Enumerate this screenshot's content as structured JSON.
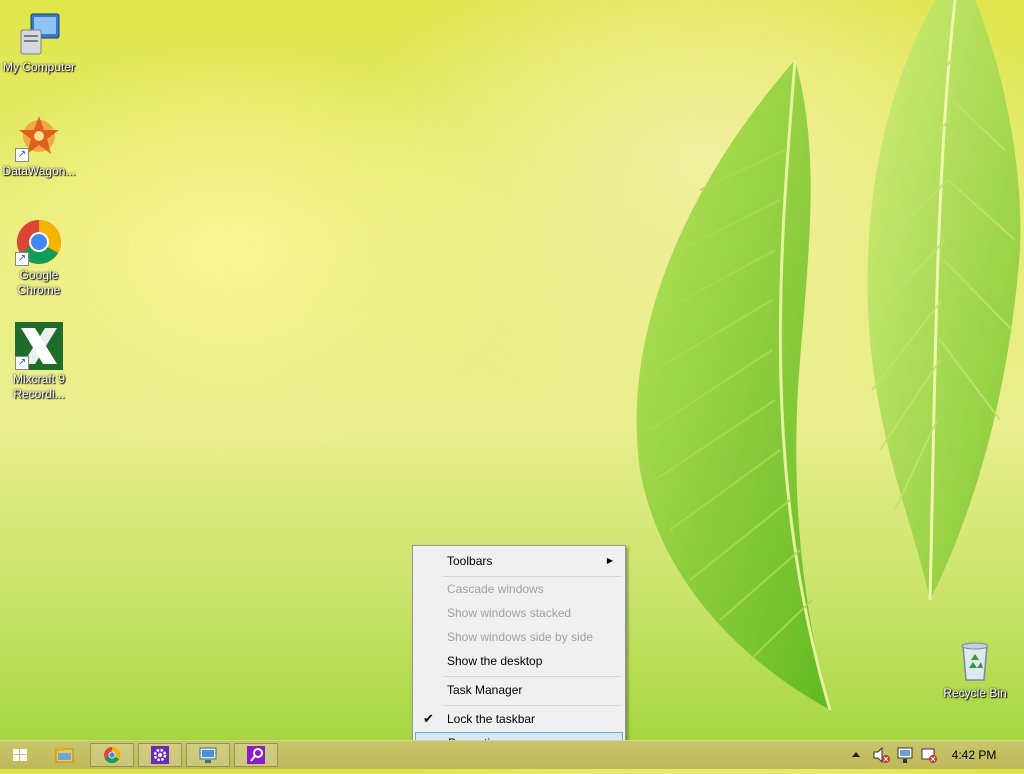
{
  "desktop": {
    "icons": [
      {
        "label": "My Computer",
        "icon": "computer-icon"
      },
      {
        "label": "DataWagon...",
        "icon": "datawagon-icon"
      },
      {
        "label": "Google Chrome",
        "icon": "chrome-icon"
      },
      {
        "label": "Mixcraft 9 Recordi...",
        "icon": "mixcraft-icon"
      },
      {
        "label": "Recycle Bin",
        "icon": "recycle-bin-icon"
      }
    ]
  },
  "context_menu": {
    "items": [
      {
        "label": "Toolbars",
        "enabled": true,
        "submenu": true
      },
      {
        "label": "Cascade windows",
        "enabled": false
      },
      {
        "label": "Show windows stacked",
        "enabled": false
      },
      {
        "label": "Show windows side by side",
        "enabled": false
      },
      {
        "label": "Show the desktop",
        "enabled": true
      },
      {
        "label": "Task Manager",
        "enabled": true
      },
      {
        "label": "Lock the taskbar",
        "enabled": true,
        "checked": true
      },
      {
        "label": "Properties",
        "enabled": true,
        "highlighted": true
      }
    ]
  },
  "taskbar": {
    "buttons": [
      {
        "icon": "windows-start-icon"
      },
      {
        "icon": "file-explorer-icon"
      },
      {
        "icon": "chrome-icon"
      },
      {
        "icon": "settings-app-icon"
      },
      {
        "icon": "remote-desktop-icon"
      },
      {
        "icon": "search-app-icon"
      }
    ],
    "tray": {
      "icons": [
        "show-hidden-icons-chevron",
        "volume-muted-icon",
        "network-icon",
        "action-center-icon"
      ],
      "clock": "4:42 PM"
    }
  },
  "colors": {
    "menu_highlight": "#d5e7f8",
    "taskbar": "#c3bf60",
    "disabled_text": "#a0a0a0"
  }
}
